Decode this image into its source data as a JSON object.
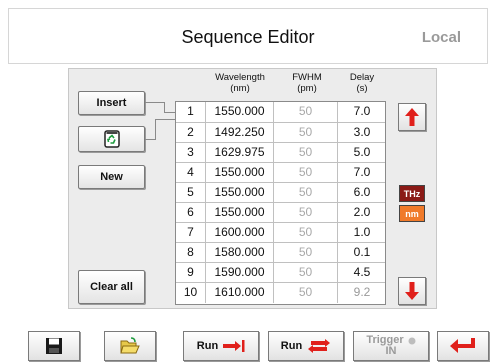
{
  "header": {
    "title": "Sequence Editor",
    "mode": "Local"
  },
  "buttons": {
    "insert": "Insert",
    "new": "New",
    "clear_all": "Clear all"
  },
  "columns": {
    "wavelength": "Wavelength",
    "wavelength_unit": "(nm)",
    "fwhm": "FWHM",
    "fwhm_unit": "(pm)",
    "delay": "Delay",
    "delay_unit": "(s)"
  },
  "rows": [
    {
      "idx": "1",
      "wavelength": "1550.000",
      "fwhm": "50",
      "delay": "7.0"
    },
    {
      "idx": "2",
      "wavelength": "1492.250",
      "fwhm": "50",
      "delay": "3.0"
    },
    {
      "idx": "3",
      "wavelength": "1629.975",
      "fwhm": "50",
      "delay": "5.0"
    },
    {
      "idx": "4",
      "wavelength": "1550.000",
      "fwhm": "50",
      "delay": "7.0"
    },
    {
      "idx": "5",
      "wavelength": "1550.000",
      "fwhm": "50",
      "delay": "6.0"
    },
    {
      "idx": "6",
      "wavelength": "1550.000",
      "fwhm": "50",
      "delay": "2.0"
    },
    {
      "idx": "7",
      "wavelength": "1600.000",
      "fwhm": "50",
      "delay": "1.0"
    },
    {
      "idx": "8",
      "wavelength": "1580.000",
      "fwhm": "50",
      "delay": "0.1"
    },
    {
      "idx": "9",
      "wavelength": "1590.000",
      "fwhm": "50",
      "delay": "4.5"
    },
    {
      "idx": "10",
      "wavelength": "1610.000",
      "fwhm": "50",
      "delay": "9.2"
    }
  ],
  "units": {
    "thz": "THz",
    "nm": "nm"
  },
  "toolbar": {
    "run_once": "Run",
    "run_loop": "Run",
    "trigger": "Trigger",
    "trigger_sub": "IN"
  },
  "colors": {
    "accent_red": "#e0201b",
    "thz_bg": "#8b1a16",
    "nm_bg": "#f07a2a"
  }
}
